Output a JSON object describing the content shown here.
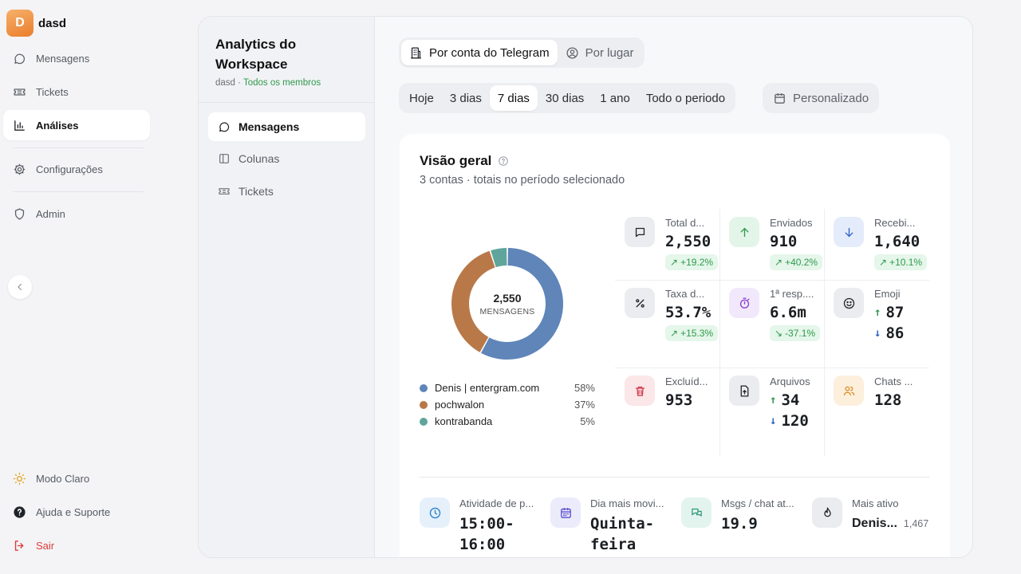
{
  "workspace": {
    "initial": "D",
    "name": "dasd"
  },
  "app_nav": {
    "items": [
      {
        "label": "Mensagens",
        "icon": "message-icon"
      },
      {
        "label": "Tickets",
        "icon": "ticket-icon"
      },
      {
        "label": "Análises",
        "icon": "chart-icon",
        "active": true
      },
      {
        "label": "Configurações",
        "icon": "gear-icon"
      },
      {
        "label": "Admin",
        "icon": "shield-icon"
      }
    ],
    "footer": [
      {
        "label": "Modo Claro",
        "icon": "sun-icon"
      },
      {
        "label": "Ajuda e Suporte",
        "icon": "help-icon"
      },
      {
        "label": "Sair",
        "icon": "logout-icon"
      }
    ]
  },
  "subnav": {
    "title": "Analytics do Workspace",
    "sub_prefix": "dasd",
    "sub_sep": " · ",
    "sub_scope": "Todos os membros",
    "items": [
      {
        "label": "Mensagens",
        "active": true
      },
      {
        "label": "Colunas"
      },
      {
        "label": "Tickets"
      }
    ]
  },
  "view_toggle": {
    "options": [
      "Por conta do Telegram",
      "Por lugar"
    ],
    "selected": "Por conta do Telegram"
  },
  "period": {
    "options": [
      "Hoje",
      "3 dias",
      "7 dias",
      "30 dias",
      "1 ano",
      "Todo o periodo"
    ],
    "selected": "7 dias",
    "custom_label": "Personalizado"
  },
  "overview": {
    "title": "Visão geral",
    "subtitle": "3 contas · totais no período selecionado",
    "donut_value": "2,550",
    "donut_label": "MENSAGENS",
    "legend": [
      {
        "name": "Denis | entergram.com",
        "pct": "58%",
        "value": 58,
        "color": "#5f85b9"
      },
      {
        "name": "pochwalon",
        "pct": "37%",
        "value": 37,
        "color": "#b97848"
      },
      {
        "name": "kontrabanda",
        "pct": "5%",
        "value": 5,
        "color": "#5fa59b"
      }
    ]
  },
  "stats": {
    "total": {
      "label": "Total d...",
      "value": "2,550",
      "change": "+19.2%"
    },
    "sent": {
      "label": "Enviados",
      "value": "910",
      "change": "+40.2%"
    },
    "received": {
      "label": "Recebi...",
      "value": "1,640",
      "change": "+10.1%"
    },
    "rate": {
      "label": "Taxa d...",
      "value": "53.7%",
      "change": "+15.3%"
    },
    "first_resp": {
      "label": "1ª resp....",
      "value": "6.6m",
      "change": "-37.1%"
    },
    "emoji": {
      "label": "Emoji",
      "up": "87",
      "down": "86"
    },
    "deleted": {
      "label": "Excluíd...",
      "value": "953"
    },
    "files": {
      "label": "Arquivos",
      "up": "34",
      "down": "120"
    },
    "chats": {
      "label": "Chats ...",
      "value": "128"
    }
  },
  "bottom_stats": {
    "peak": {
      "label": "Atividade de p...",
      "value": "15:00-16:00"
    },
    "busy_day": {
      "label": "Dia mais movi...",
      "value": "Quinta-feira"
    },
    "per_chat": {
      "label": "Msgs / chat at...",
      "value": "19.9"
    },
    "most_active": {
      "label": "Mais ativo",
      "name": "Denis...",
      "count": "1,467"
    }
  },
  "colors": {
    "green": "#2f9a4c",
    "blue": "#2e64c8",
    "logout_red": "#dc3a3a",
    "brand_orange": "#ea7e2c"
  }
}
